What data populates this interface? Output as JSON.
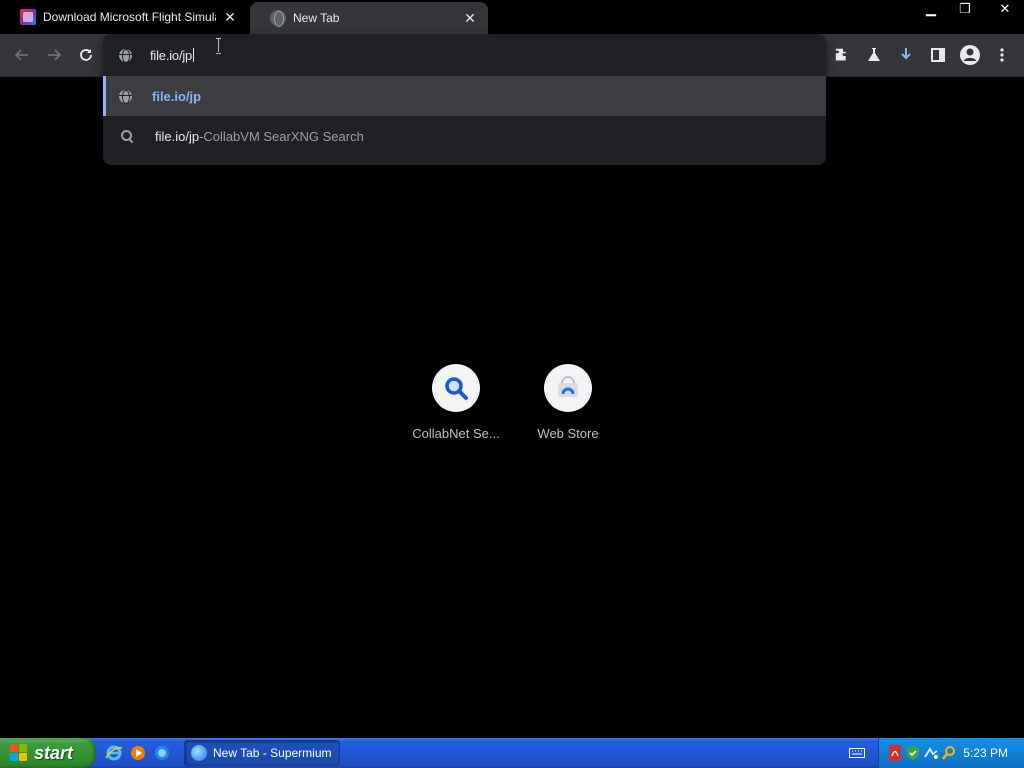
{
  "tabs": [
    {
      "title": "Download Microsoft Flight Simulator",
      "favicon": "msfs-icon",
      "active": false
    },
    {
      "title": "New Tab",
      "favicon": "globe-icon",
      "active": true
    }
  ],
  "window_controls": {
    "minimize": "▁",
    "restore": "❐",
    "close": "✕"
  },
  "omnibox": {
    "typed": "file.io/jp",
    "suggestions": [
      {
        "icon": "globe-icon",
        "url": "file.io/jp"
      },
      {
        "icon": "search-icon",
        "query": "file.io/jp",
        "separator": " - ",
        "engine": "CollabVM SearXNG Search"
      }
    ]
  },
  "toolbar_icons": [
    "extensions-icon",
    "labs-icon",
    "download-icon",
    "side-panel-icon",
    "profile-icon",
    "menu-icon"
  ],
  "shortcuts": [
    {
      "label": "CollabNet Se...",
      "icon": "search-icon"
    },
    {
      "label": "Web Store",
      "icon": "web-store-icon"
    }
  ],
  "taskbar": {
    "start_label": "start",
    "task_label": "New Tab - Supermium",
    "clock": "5:23 PM"
  },
  "colors": {
    "accent": "#8ab4f8",
    "taskbar": "#245edb",
    "start": "#3c9b3c"
  }
}
